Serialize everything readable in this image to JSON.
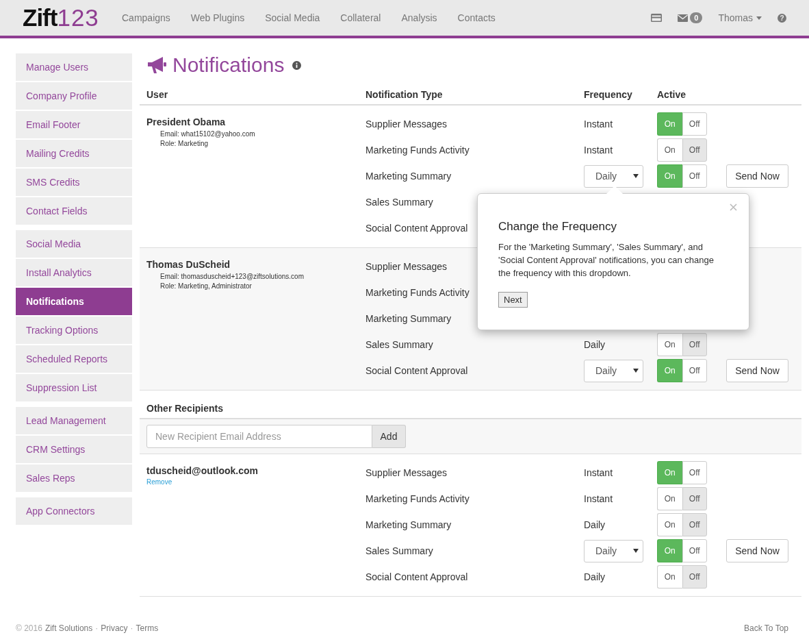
{
  "navbar": {
    "logo": {
      "word": "Zift",
      "digits": "123"
    },
    "links": [
      "Campaigns",
      "Web Plugins",
      "Social Media",
      "Collateral",
      "Analysis",
      "Contacts"
    ],
    "message_count": "0",
    "user": "Thomas",
    "help_glyph": "?"
  },
  "sidebar": {
    "groups": [
      [
        {
          "label": "Manage Users",
          "selected": false
        },
        {
          "label": "Company Profile",
          "selected": false
        },
        {
          "label": "Email Footer",
          "selected": false
        },
        {
          "label": "Mailing Credits",
          "selected": false
        },
        {
          "label": "SMS Credits",
          "selected": false
        },
        {
          "label": "Contact Fields",
          "selected": false
        }
      ],
      [
        {
          "label": "Social Media",
          "selected": false
        },
        {
          "label": "Install Analytics",
          "selected": false
        },
        {
          "label": "Notifications",
          "selected": true
        },
        {
          "label": "Tracking Options",
          "selected": false
        },
        {
          "label": "Scheduled Reports",
          "selected": false
        },
        {
          "label": "Suppression List",
          "selected": false
        }
      ],
      [
        {
          "label": "Lead Management",
          "selected": false
        },
        {
          "label": "CRM Settings",
          "selected": false
        },
        {
          "label": "Sales Reps",
          "selected": false
        }
      ],
      [
        {
          "label": "App Connectors",
          "selected": false
        }
      ]
    ]
  },
  "page": {
    "title": "Notifications"
  },
  "table": {
    "columns": [
      "User",
      "Notification Type",
      "Frequency",
      "Active"
    ],
    "users": [
      {
        "name": "President Obama",
        "email": "Email: what15102@yahoo.com",
        "role": "Role: Marketing",
        "rows": [
          {
            "type": "Supplier Messages",
            "frequency": {
              "kind": "text",
              "value": "Instant"
            },
            "toggle": {
              "on_label": "On",
              "off_label": "Off",
              "active": true
            }
          },
          {
            "type": "Marketing Funds Activity",
            "frequency": {
              "kind": "text",
              "value": "Instant"
            },
            "toggle": {
              "on_label": "On",
              "off_label": "Off",
              "active": false
            }
          },
          {
            "type": "Marketing Summary",
            "frequency": {
              "kind": "dropdown",
              "value": "Daily"
            },
            "toggle": {
              "on_label": "On",
              "off_label": "Off",
              "active": true
            },
            "send_label": "Send Now"
          },
          {
            "type": "Sales Summary"
          },
          {
            "type": "Social Content Approval"
          }
        ]
      },
      {
        "name": "Thomas DuScheid",
        "email": "Email: thomasduscheid+123@ziftsolutions.com",
        "role": "Role: Marketing, Administrator",
        "rows": [
          {
            "type": "Supplier Messages"
          },
          {
            "type": "Marketing Funds Activity"
          },
          {
            "type": "Marketing Summary"
          },
          {
            "type": "Sales Summary",
            "frequency": {
              "kind": "text",
              "value": "Daily"
            },
            "toggle": {
              "on_label": "On",
              "off_label": "Off",
              "active": false
            }
          },
          {
            "type": "Social Content Approval",
            "frequency": {
              "kind": "dropdown",
              "value": "Daily"
            },
            "toggle": {
              "on_label": "On",
              "off_label": "Off",
              "active": true
            },
            "send_label": "Send Now"
          }
        ]
      }
    ]
  },
  "other_recipients": {
    "heading": "Other Recipients",
    "placeholder": "New Recipient Email Address",
    "add_label": "Add",
    "recipients": [
      {
        "email": "tduscheid@outlook.com",
        "remove_label": "Remove",
        "rows": [
          {
            "type": "Supplier Messages",
            "frequency": {
              "kind": "text",
              "value": "Instant"
            },
            "toggle": {
              "on_label": "On",
              "off_label": "Off",
              "active": true
            }
          },
          {
            "type": "Marketing Funds Activity",
            "frequency": {
              "kind": "text",
              "value": "Instant"
            },
            "toggle": {
              "on_label": "On",
              "off_label": "Off",
              "active": false
            }
          },
          {
            "type": "Marketing Summary",
            "frequency": {
              "kind": "text",
              "value": "Daily"
            },
            "toggle": {
              "on_label": "On",
              "off_label": "Off",
              "active": false
            }
          },
          {
            "type": "Sales Summary",
            "frequency": {
              "kind": "dropdown",
              "value": "Daily"
            },
            "toggle": {
              "on_label": "On",
              "off_label": "Off",
              "active": true
            },
            "send_label": "Send Now"
          },
          {
            "type": "Social Content Approval",
            "frequency": {
              "kind": "text",
              "value": "Daily"
            },
            "toggle": {
              "on_label": "On",
              "off_label": "Off",
              "active": false
            }
          }
        ]
      }
    ]
  },
  "popover": {
    "title": "Change the Frequency",
    "body": "For the 'Marketing Summary', 'Sales Summary', and 'Social Content Approval' notifications, you can change the frequency with this dropdown.",
    "next_label": "Next"
  },
  "footer": {
    "copyright": "© 2016",
    "company": "Zift Solutions",
    "links": [
      {
        "separator": "·",
        "label": "Privacy"
      },
      {
        "separator": "·",
        "label": "Terms"
      }
    ],
    "back_to_top": "Back To Top"
  }
}
